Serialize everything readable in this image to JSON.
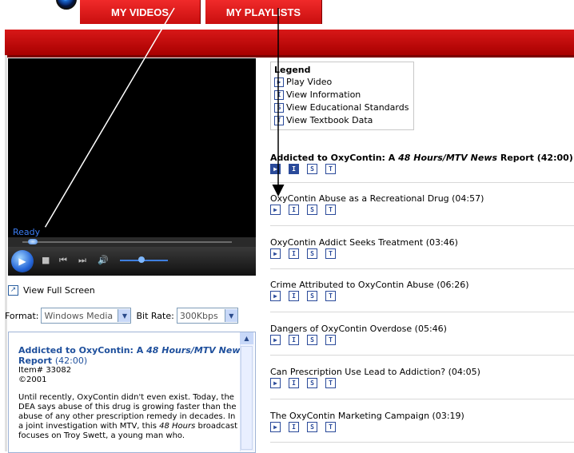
{
  "nav": {
    "my_videos": "MY VIDEOS",
    "my_playlists": "MY PLAYLISTS"
  },
  "player": {
    "status": "Ready",
    "seek_progress": 0.05,
    "volume_level": 0.45,
    "fullscreen_label": "View Full Screen"
  },
  "format": {
    "label": "Format:",
    "value": "Windows Media",
    "bitrate_label": "Bit Rate:",
    "bitrate_value": "300Kbps"
  },
  "info": {
    "title_plain": "Addicted to OxyContin: A ",
    "title_italic": "48 Hours/MTV News",
    "title_after": " Report",
    "duration": "(42:00)",
    "item": "Item# 33082",
    "year": "©2001",
    "body_1": "Until recently, OxyContin didn't even exist. Today, the DEA says abuse of this drug is growing faster than the abuse of any other prescription remedy in decades. In a joint investigation with MTV, this ",
    "body_italic": "48 Hours",
    "body_2": " broadcast focuses on Troy Swett, a young man who."
  },
  "legend": {
    "title": "Legend",
    "items": [
      {
        "icon": "▶",
        "label": "Play Video"
      },
      {
        "icon": "I",
        "label": "View Information"
      },
      {
        "icon": "S",
        "label": "View Educational Standards"
      },
      {
        "icon": "T",
        "label": "View Textbook Data"
      }
    ]
  },
  "videos": {
    "main": {
      "title_plain": "Addicted to OxyContin: A ",
      "title_italic": "48 Hours/MTV News",
      "title_after": " Report (42:00)"
    },
    "items": [
      {
        "title": "OxyContin Abuse as a Recreational Drug (04:57)"
      },
      {
        "title": "OxyContin Addict Seeks Treatment (03:46)"
      },
      {
        "title": "Crime Attributed to OxyContin Abuse (06:26)"
      },
      {
        "title": "Dangers of OxyContin Overdose (05:46)"
      },
      {
        "title": "Can Prescription Use Lead to Addiction? (04:05)"
      },
      {
        "title": "The OxyContin Marketing Campaign (03:19)"
      }
    ]
  },
  "icons": {
    "play": "▶",
    "info": "I",
    "standards": "S",
    "textbook": "T"
  }
}
